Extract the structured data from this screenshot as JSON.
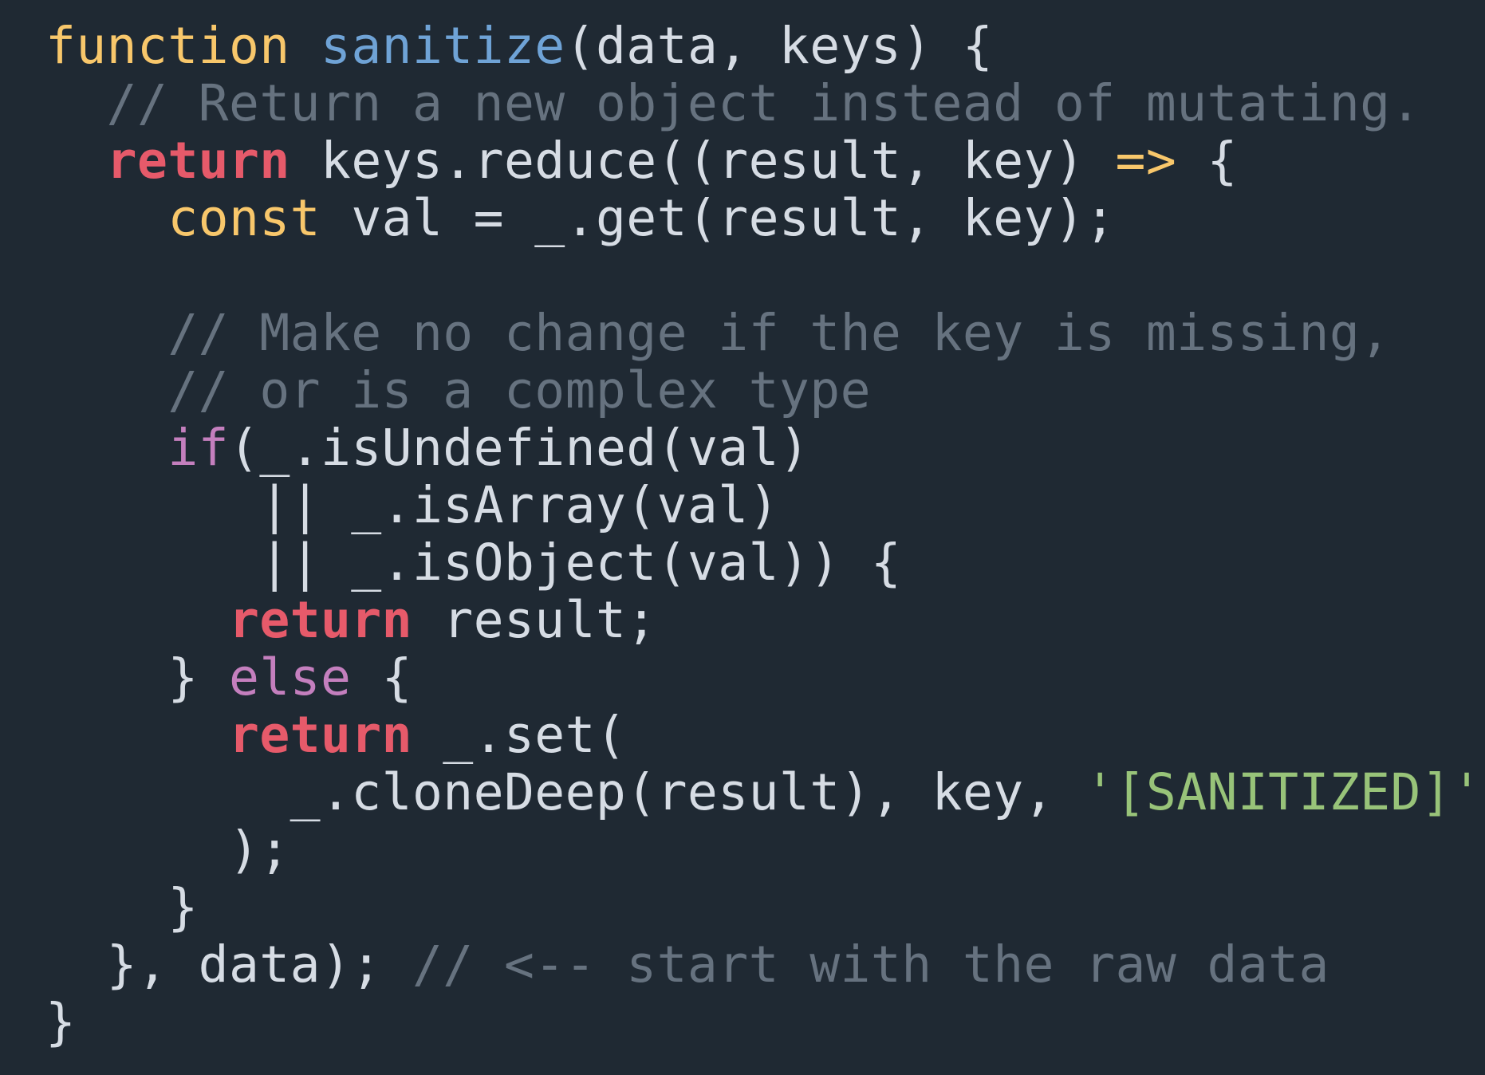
{
  "theme": {
    "background": "#1f2933",
    "default": "#d6dce4",
    "keyword_decl": "#f8c76b",
    "function_name": "#6fa3d6",
    "comment": "#66727f",
    "keyword_return": "#e65a6a",
    "keyword_control": "#c47fbe",
    "arrow": "#f8c76b",
    "string": "#98c379"
  },
  "code": {
    "lines": [
      {
        "tokens": [
          {
            "t": "function",
            "k": "keyword_decl"
          },
          {
            "t": " ",
            "k": "default"
          },
          {
            "t": "sanitize",
            "k": "function_name"
          },
          {
            "t": "(data, keys) {",
            "k": "default"
          }
        ]
      },
      {
        "tokens": [
          {
            "t": "  ",
            "k": "default"
          },
          {
            "t": "// Return a new object instead of mutating.",
            "k": "comment"
          }
        ]
      },
      {
        "tokens": [
          {
            "t": "  ",
            "k": "default"
          },
          {
            "t": "return",
            "k": "keyword_return",
            "bold": true
          },
          {
            "t": " keys.reduce((result, key) ",
            "k": "default"
          },
          {
            "t": "=>",
            "k": "arrow"
          },
          {
            "t": " {",
            "k": "default"
          }
        ]
      },
      {
        "tokens": [
          {
            "t": "    ",
            "k": "default"
          },
          {
            "t": "const",
            "k": "keyword_decl"
          },
          {
            "t": " val = _.get(result, key);",
            "k": "default"
          }
        ]
      },
      {
        "tokens": []
      },
      {
        "tokens": [
          {
            "t": "    ",
            "k": "default"
          },
          {
            "t": "// Make no change if the key is missing,",
            "k": "comment"
          }
        ]
      },
      {
        "tokens": [
          {
            "t": "    ",
            "k": "default"
          },
          {
            "t": "// or is a complex type",
            "k": "comment"
          }
        ]
      },
      {
        "tokens": [
          {
            "t": "    ",
            "k": "default"
          },
          {
            "t": "if",
            "k": "keyword_control"
          },
          {
            "t": "(_.isUndefined(val)",
            "k": "default"
          }
        ]
      },
      {
        "tokens": [
          {
            "t": "       || _.isArray(val)",
            "k": "default"
          }
        ]
      },
      {
        "tokens": [
          {
            "t": "       || _.isObject(val)) {",
            "k": "default"
          }
        ]
      },
      {
        "tokens": [
          {
            "t": "      ",
            "k": "default"
          },
          {
            "t": "return",
            "k": "keyword_return",
            "bold": true
          },
          {
            "t": " result;",
            "k": "default"
          }
        ]
      },
      {
        "tokens": [
          {
            "t": "    } ",
            "k": "default"
          },
          {
            "t": "else",
            "k": "keyword_control"
          },
          {
            "t": " {",
            "k": "default"
          }
        ]
      },
      {
        "tokens": [
          {
            "t": "      ",
            "k": "default"
          },
          {
            "t": "return",
            "k": "keyword_return",
            "bold": true
          },
          {
            "t": " _.set(",
            "k": "default"
          }
        ]
      },
      {
        "tokens": [
          {
            "t": "        _.cloneDeep(result), key, ",
            "k": "default"
          },
          {
            "t": "'[SANITIZED]'",
            "k": "string"
          }
        ]
      },
      {
        "tokens": [
          {
            "t": "      );",
            "k": "default"
          }
        ]
      },
      {
        "tokens": [
          {
            "t": "    }",
            "k": "default"
          }
        ]
      },
      {
        "tokens": [
          {
            "t": "  }, data); ",
            "k": "default"
          },
          {
            "t": "// <-- start with the raw data",
            "k": "comment"
          }
        ]
      },
      {
        "tokens": [
          {
            "t": "}",
            "k": "default"
          }
        ]
      }
    ]
  }
}
